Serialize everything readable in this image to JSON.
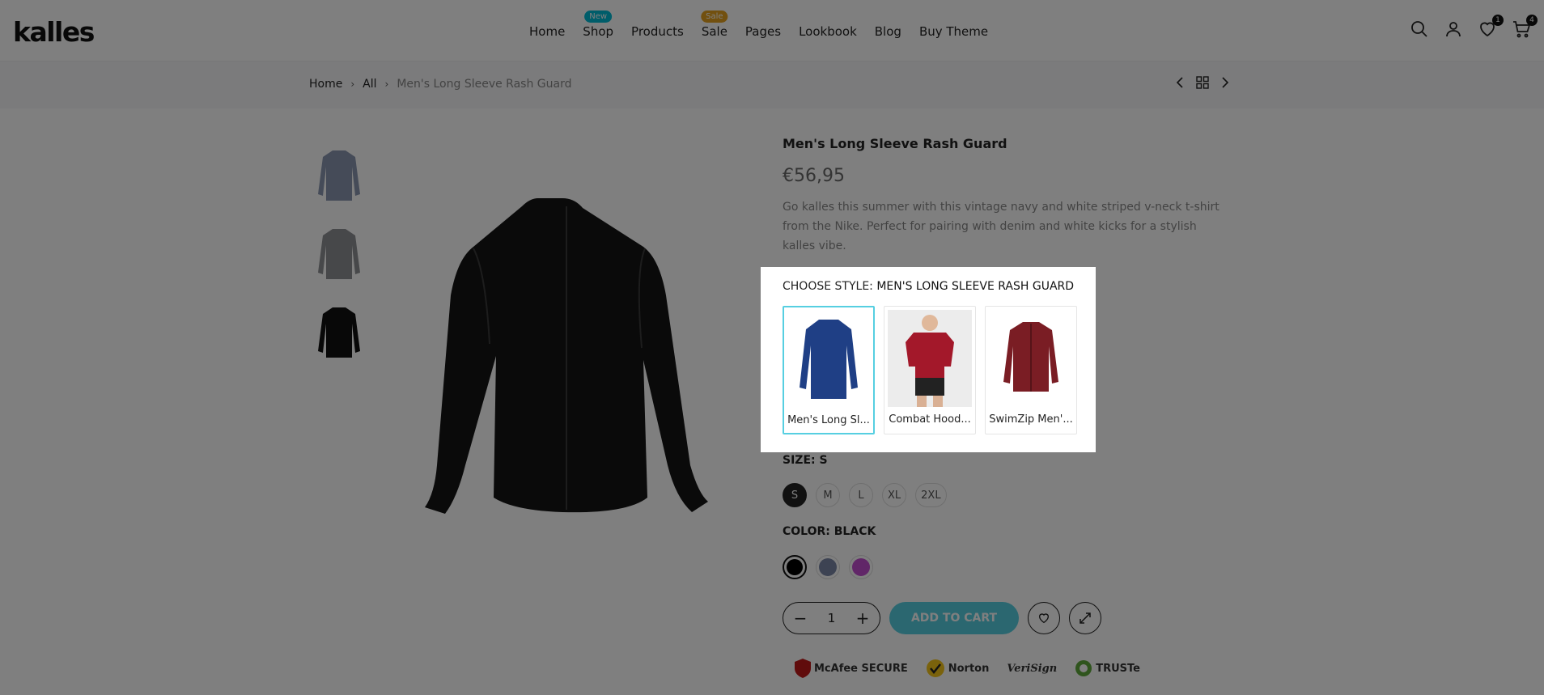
{
  "header": {
    "logo": "kalles",
    "nav": [
      {
        "label": "Home"
      },
      {
        "label": "Shop",
        "badge": "New"
      },
      {
        "label": "Products"
      },
      {
        "label": "Sale",
        "badge": "Sale"
      },
      {
        "label": "Pages"
      },
      {
        "label": "Lookbook"
      },
      {
        "label": "Blog"
      },
      {
        "label": "Buy Theme"
      }
    ],
    "wishlist_count": "1",
    "cart_count": "4"
  },
  "breadcrumb": {
    "home": "Home",
    "all": "All",
    "current": "Men's Long Sleeve Rash Guard"
  },
  "product": {
    "title": "Men's Long Sleeve Rash Guard",
    "price": "€56,95",
    "description": "Go kalles this summer with this vintage navy and white striped v-neck t-shirt from the Nike. Perfect for pairing with denim and white kicks for a stylish kalles vibe.",
    "size_label": "SIZE:",
    "size_value": "S",
    "sizes": [
      "S",
      "M",
      "L",
      "XL",
      "2XL"
    ],
    "selected_size": "S",
    "color_label": "COLOR:",
    "color_value": "BLACK",
    "colors": [
      {
        "name": "black",
        "hex": "#000000"
      },
      {
        "name": "blue-gray",
        "hex": "#7a86a6"
      },
      {
        "name": "purple",
        "hex": "#c24dd0"
      }
    ],
    "quantity": "1",
    "add_to_cart": "ADD TO CART",
    "thumbnails": [
      {
        "color": "#8a97b1"
      },
      {
        "color": "#8f9094"
      },
      {
        "color": "#111111"
      }
    ],
    "trust_badges": [
      "McAfee SECURE",
      "Norton",
      "VeriSign",
      "TRUSTe"
    ]
  },
  "popup": {
    "label": "CHOOSE STYLE:",
    "value": "MEN'S LONG SLEEVE RASH GUARD",
    "options": [
      {
        "label": "Men's Long Sl...",
        "color": "#1f3f85"
      },
      {
        "label": "Combat Hood...",
        "color": "#a3182a"
      },
      {
        "label": "SwimZip Men'...",
        "color": "#7a1d24"
      }
    ]
  }
}
